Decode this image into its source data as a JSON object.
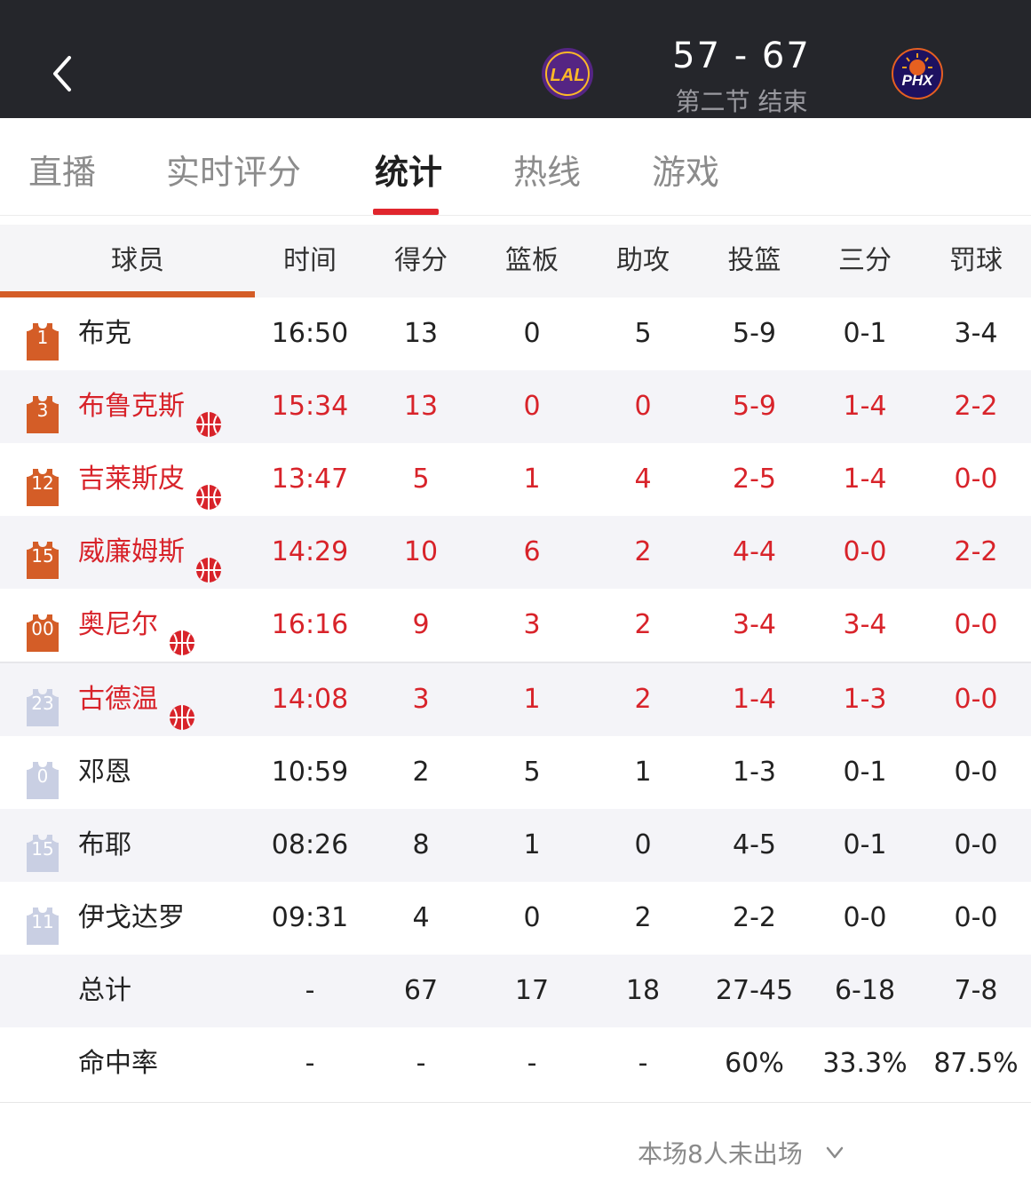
{
  "header": {
    "score": "57 - 67",
    "period": "第二节 结束",
    "home_logo_text": "LAL",
    "away_logo_text": "PHX"
  },
  "tabs": [
    {
      "label": "直播"
    },
    {
      "label": "实时评分"
    },
    {
      "label": "统计"
    },
    {
      "label": "热线"
    },
    {
      "label": "游戏"
    }
  ],
  "active_tab": "统计",
  "table": {
    "headers": [
      "球员",
      "时间",
      "得分",
      "篮板",
      "助攻",
      "投篮",
      "三分",
      "罚球"
    ],
    "rows": [
      {
        "num": "1",
        "name": "布克",
        "highlight": false,
        "starter": true,
        "ball": false,
        "stats": [
          "16:50",
          "13",
          "0",
          "5",
          "5-9",
          "0-1",
          "3-4"
        ]
      },
      {
        "num": "3",
        "name": "布鲁克斯",
        "highlight": true,
        "starter": true,
        "ball": true,
        "stats": [
          "15:34",
          "13",
          "0",
          "0",
          "5-9",
          "1-4",
          "2-2"
        ]
      },
      {
        "num": "12",
        "name": "吉莱斯皮",
        "highlight": true,
        "starter": true,
        "ball": true,
        "stats": [
          "13:47",
          "5",
          "1",
          "4",
          "2-5",
          "1-4",
          "0-0"
        ]
      },
      {
        "num": "15",
        "name": "威廉姆斯",
        "highlight": true,
        "starter": true,
        "ball": true,
        "stats": [
          "14:29",
          "10",
          "6",
          "2",
          "4-4",
          "0-0",
          "2-2"
        ]
      },
      {
        "num": "00",
        "name": "奥尼尔",
        "highlight": true,
        "starter": true,
        "ball": true,
        "stats": [
          "16:16",
          "9",
          "3",
          "2",
          "3-4",
          "3-4",
          "0-0"
        ]
      },
      {
        "num": "23",
        "name": "古德温",
        "highlight": true,
        "starter": false,
        "ball": true,
        "stats": [
          "14:08",
          "3",
          "1",
          "2",
          "1-4",
          "1-3",
          "0-0"
        ]
      },
      {
        "num": "0",
        "name": "邓恩",
        "highlight": false,
        "starter": false,
        "ball": false,
        "stats": [
          "10:59",
          "2",
          "5",
          "1",
          "1-3",
          "0-1",
          "0-0"
        ]
      },
      {
        "num": "15",
        "name": "布耶",
        "highlight": false,
        "starter": false,
        "ball": false,
        "stats": [
          "08:26",
          "8",
          "1",
          "0",
          "4-5",
          "0-1",
          "0-0"
        ]
      },
      {
        "num": "11",
        "name": "伊戈达罗",
        "highlight": false,
        "starter": false,
        "ball": false,
        "stats": [
          "09:31",
          "4",
          "0",
          "2",
          "2-2",
          "0-0",
          "0-0"
        ]
      }
    ],
    "totals": {
      "label": "总计",
      "stats": [
        "-",
        "67",
        "17",
        "18",
        "27-45",
        "6-18",
        "7-8"
      ]
    },
    "percentages": {
      "label": "命中率",
      "stats": [
        "-",
        "-",
        "-",
        "-",
        "60%",
        "33.3%",
        "87.5%"
      ]
    }
  },
  "footer": {
    "more_label": "本场8人未出场"
  },
  "colors": {
    "header_bg": "#25262b",
    "accent_red": "#d8232a",
    "starter_jersey": "#d45d27",
    "bench_jersey": "#c9cfe3",
    "lakers_purple": "#552583",
    "lakers_gold": "#fdb927"
  }
}
